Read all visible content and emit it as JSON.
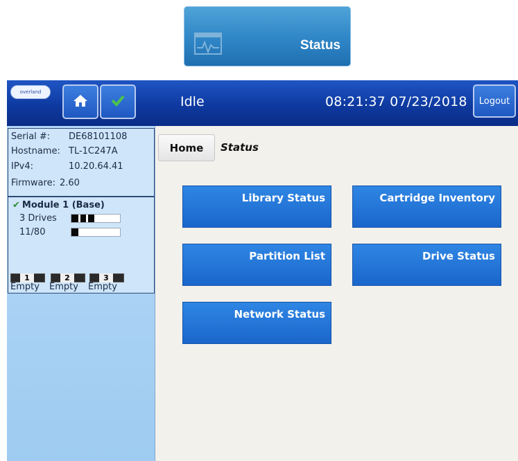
{
  "status_tile": {
    "label": "Status",
    "icon": "activity-monitor-icon"
  },
  "topbar": {
    "logo_text": "overland",
    "state": "Idle",
    "clock": "08:21:37  07/23/2018",
    "logout_label": "Logout",
    "home_icon": "home-icon",
    "check_icon": "checkmark-icon"
  },
  "info": {
    "serial_label": "Serial #:",
    "serial_value": "DE68101108",
    "hostname_label": "Hostname:",
    "hostname_value": "TL-1C247A",
    "ipv4_label": "IPv4:",
    "ipv4_value": "10.20.64.41",
    "firmware_label": "Firmware:",
    "firmware_value": "2.60"
  },
  "module": {
    "title": "Module 1 (Base)",
    "drives_label": "3 Drives",
    "drives_fill_fraction": 0.47,
    "slots_label": "11/80",
    "slots_fill_fraction": 0.14,
    "slots": [
      {
        "num": "1",
        "label": "Empty"
      },
      {
        "num": "2",
        "label": "Empty"
      },
      {
        "num": "3",
        "label": "Empty"
      }
    ]
  },
  "breadcrumb": {
    "home": "Home",
    "current": "Status"
  },
  "tiles": {
    "library_status": "Library Status",
    "cartridge_inventory": "Cartridge Inventory",
    "partition_list": "Partition List",
    "drive_status": "Drive Status",
    "network_status": "Network Status"
  },
  "colors": {
    "accent": "#1a66cc",
    "topbar": "#0e3aa0",
    "sidebar": "#b6d8f7"
  }
}
